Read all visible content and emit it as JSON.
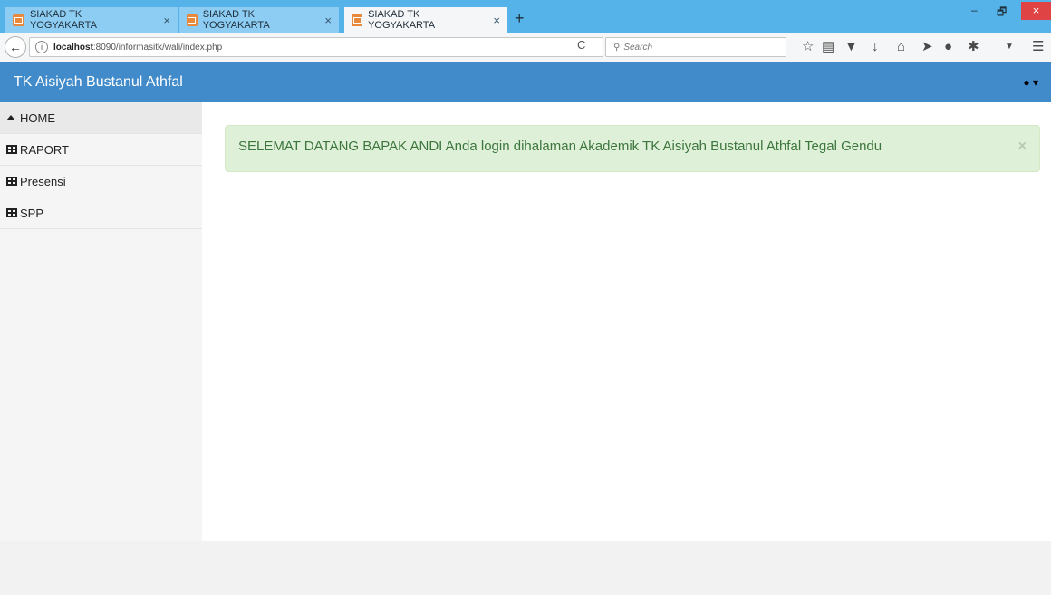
{
  "browser": {
    "tabs": [
      {
        "label": "SIAKAD TK YOGYAKARTA",
        "close": "×"
      },
      {
        "label": "SIAKAD TK YOGYAKARTA",
        "close": "×"
      },
      {
        "label": "SIAKAD TK YOGYAKARTA",
        "close": "×"
      }
    ],
    "new_tab": "+",
    "minimize": "–",
    "restore": "🗗",
    "close": "×",
    "back": "←",
    "info": "i",
    "url_host": "localhost",
    "url_rest": ":8090/informasitk/wali/index.php",
    "reload": "C",
    "search_placeholder": "Search",
    "toolbar_icons": [
      "star-icon",
      "reading-list-icon",
      "pocket-icon",
      "download-icon",
      "home-icon",
      "send-icon",
      "chat-icon",
      "extension-icon",
      "dropdown-icon",
      "menu-icon"
    ]
  },
  "app": {
    "brand": "TK Aisiyah Bustanul Athfal",
    "user_menu": "▾"
  },
  "sidebar": {
    "items": [
      {
        "label": "HOME",
        "icon": "home-icon",
        "active": true
      },
      {
        "label": "RAPORT",
        "icon": "grid-icon"
      },
      {
        "label": "Presensi",
        "icon": "grid-icon"
      },
      {
        "label": "SPP",
        "icon": "grid-icon"
      }
    ]
  },
  "main": {
    "alert_text": "SELEMAT DATANG BAPAK ANDI Anda login dihalaman Akademik TK Aisiyah Bustanul Athfal Tegal Gendu",
    "alert_close": "×"
  },
  "colors": {
    "tab_strip": "#56b3e9",
    "app_header": "#428bca",
    "alert_bg": "#dff0d8",
    "alert_text": "#3c763d"
  }
}
